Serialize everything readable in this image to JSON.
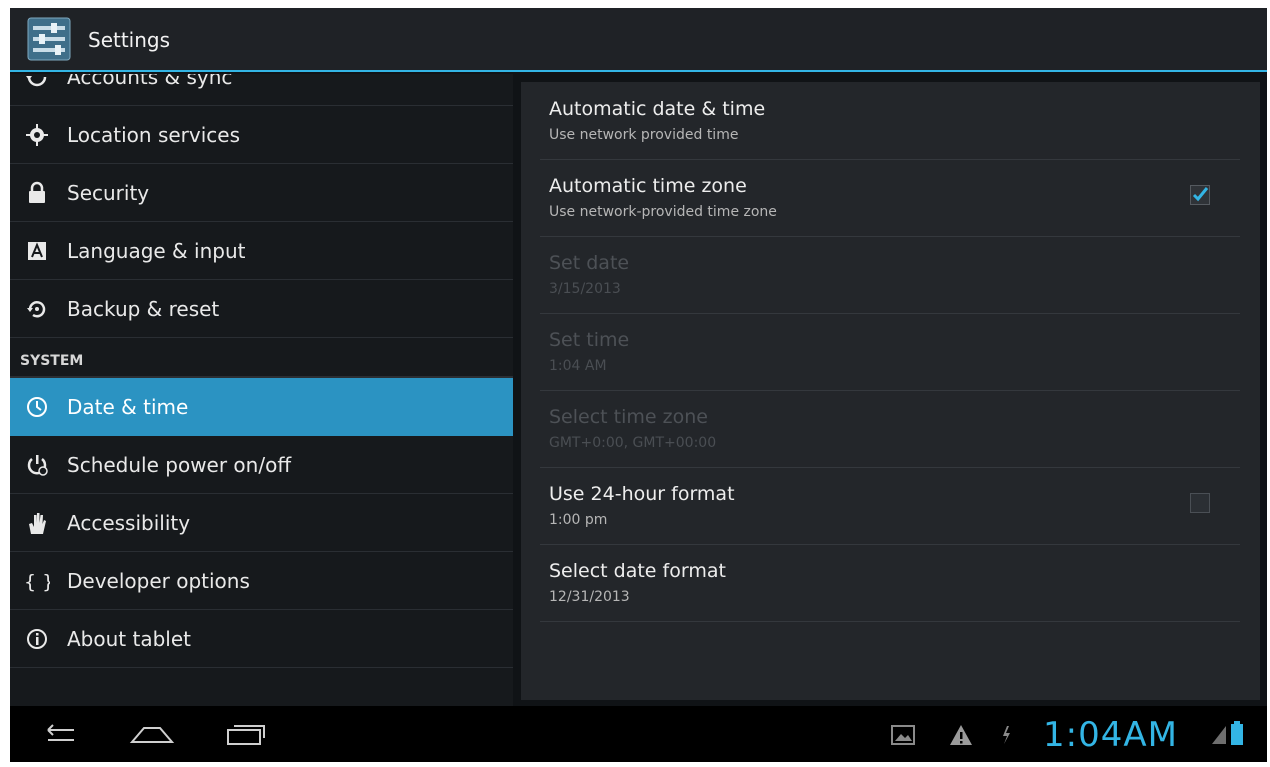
{
  "app": {
    "title": "Settings"
  },
  "sidebar": {
    "items_top": [
      {
        "label": "Accounts & sync",
        "icon": "sync-icon"
      },
      {
        "label": "Location services",
        "icon": "location-icon"
      },
      {
        "label": "Security",
        "icon": "lock-icon"
      },
      {
        "label": "Language & input",
        "icon": "language-icon"
      },
      {
        "label": "Backup & reset",
        "icon": "backup-restore-icon"
      }
    ],
    "section_system": "SYSTEM",
    "items_system": [
      {
        "label": "Date & time",
        "icon": "clock-icon",
        "selected": true
      },
      {
        "label": "Schedule power on/off",
        "icon": "power-schedule-icon"
      },
      {
        "label": "Accessibility",
        "icon": "hand-icon"
      },
      {
        "label": "Developer options",
        "icon": "braces-icon"
      },
      {
        "label": "About tablet",
        "icon": "info-icon"
      }
    ]
  },
  "preferences": [
    {
      "title": "Automatic date & time",
      "summary": "Use network provided time",
      "enabled": true
    },
    {
      "title": "Automatic time zone",
      "summary": "Use network-provided time zone",
      "enabled": true,
      "checked": true
    },
    {
      "title": "Set date",
      "summary": "3/15/2013",
      "enabled": false
    },
    {
      "title": "Set time",
      "summary": "1:04 AM",
      "enabled": false
    },
    {
      "title": "Select time zone",
      "summary": "GMT+0:00, GMT+00:00",
      "enabled": false
    },
    {
      "title": "Use 24-hour format",
      "summary": "1:00 pm",
      "enabled": true,
      "checked": false
    },
    {
      "title": "Select date format",
      "summary": "12/31/2013",
      "enabled": true
    }
  ],
  "statusbar": {
    "time": "1:04AM"
  },
  "colors": {
    "accent": "#33b5e5",
    "selected_row": "#2b93c2"
  }
}
